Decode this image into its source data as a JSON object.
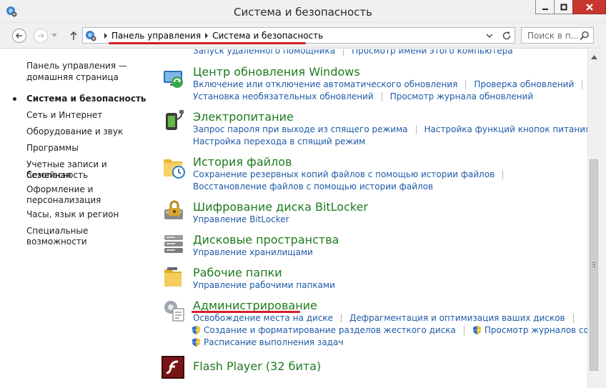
{
  "window": {
    "title": "Система и безопасность"
  },
  "address": {
    "crumbs": [
      "Панель управления",
      "Система и безопасность"
    ]
  },
  "search": {
    "placeholder": "Поиск в п..."
  },
  "sidebar": {
    "items": [
      {
        "label": "Панель управления —"
      },
      {
        "label": "домашняя страница"
      },
      {
        "label": "Система и безопасность"
      },
      {
        "label": "Сеть и Интернет"
      },
      {
        "label": "Оборудование и звук"
      },
      {
        "label": "Программы"
      },
      {
        "label": "Учетные записи и Семейная"
      },
      {
        "label": "безопасность"
      },
      {
        "label": "Оформление и"
      },
      {
        "label": "персонализация"
      },
      {
        "label": "Часы, язык и регион"
      },
      {
        "label": "Специальные возможности"
      }
    ]
  },
  "main": {
    "cut_links": [
      "Запуск удаленного помощника",
      "Просмотр имени этого компьютера"
    ],
    "sections": [
      {
        "title": "Центр обновления Windows",
        "icon": "windows-update-icon",
        "rows": [
          [
            "Включение или отключение автоматического обновления",
            "Проверка обновлений"
          ],
          [
            "Установка необязательных обновлений",
            "Просмотр журнала обновлений"
          ]
        ]
      },
      {
        "title": "Электропитание",
        "icon": "power-options-icon",
        "rows": [
          [
            "Запрос пароля при выходе из спящего режима",
            "Настройка функций кнопок питания"
          ],
          [
            "Настройка перехода в спящий режим"
          ]
        ]
      },
      {
        "title": "История файлов",
        "icon": "file-history-icon",
        "rows": [
          [
            "Сохранение резервных копий файлов с помощью истории файлов"
          ],
          [
            "Восстановление файлов с помощью истории файлов"
          ]
        ]
      },
      {
        "title": "Шифрование диска BitLocker",
        "icon": "bitlocker-icon",
        "rows": [
          [
            "Управление BitLocker"
          ]
        ]
      },
      {
        "title": "Дисковые пространства",
        "icon": "storage-spaces-icon",
        "rows": [
          [
            "Управление хранилищами"
          ]
        ]
      },
      {
        "title": "Рабочие папки",
        "icon": "work-folders-icon",
        "rows": [
          [
            "Управление рабочими папками"
          ]
        ]
      },
      {
        "title": "Администрирование",
        "icon": "administrative-tools-icon",
        "rows": [
          [
            "Освобождение места на диске",
            "Дефрагментация и оптимизация ваших дисков"
          ],
          [
            "Создание и форматирование разделов жесткого диска",
            "Просмотр журналов событий"
          ],
          [
            "Расписание выполнения задач"
          ]
        ]
      },
      {
        "title": "Flash Player (32 бита)",
        "icon": "flash-player-icon",
        "rows": []
      }
    ]
  },
  "colors": {
    "link": "#1e5aa8",
    "heading": "#1e7a1e",
    "highlight": "#d41e2a"
  }
}
